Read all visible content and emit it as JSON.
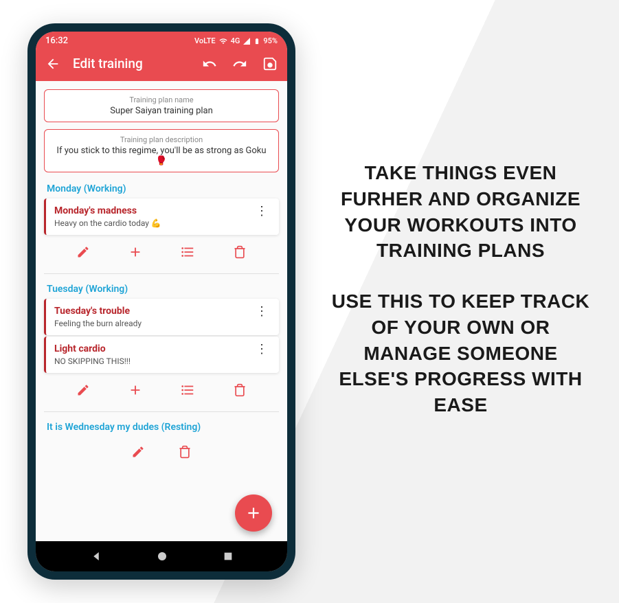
{
  "status": {
    "time": "16:32",
    "network": "VoLTE",
    "signal": "4G",
    "battery": "95%"
  },
  "appbar": {
    "title": "Edit training"
  },
  "form": {
    "name_label": "Training plan name",
    "name_value": "Super Saiyan training plan",
    "desc_label": "Training plan description",
    "desc_value": "If you stick to this regime, you'll be as strong as Goku 🥊"
  },
  "days": [
    {
      "header": "Monday (Working)",
      "workouts": [
        {
          "title": "Monday's madness",
          "desc": "Heavy on the cardio today 💪"
        }
      ],
      "actions": "full"
    },
    {
      "header": "Tuesday (Working)",
      "workouts": [
        {
          "title": "Tuesday's trouble",
          "desc": "Feeling the burn already"
        },
        {
          "title": "Light cardio",
          "desc": "NO SKIPPING THIS!!!"
        }
      ],
      "actions": "full"
    },
    {
      "header": "It is Wednesday my dudes (Resting)",
      "workouts": [],
      "actions": "edit-delete"
    }
  ],
  "marketing": {
    "p1": "Take things even furher and organize your workouts into training plans",
    "p2": "Use this to keep track of your own or manage someone else's progress with ease"
  }
}
